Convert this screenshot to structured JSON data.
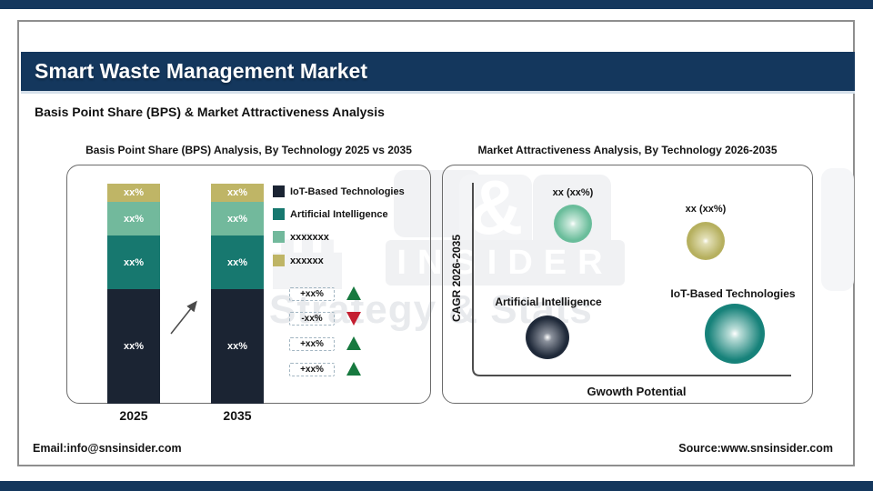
{
  "page": {
    "title": "Smart Waste Management Market",
    "subtitle": "Basis Point Share (BPS) & Market Attractiveness Analysis",
    "footer_email": "Email:info@snsinsider.com",
    "footer_source": "Source:www.snsinsider.com"
  },
  "watermark": {
    "ampersand": "&",
    "insider": "INSIDER",
    "tagline": "Strategy & Stats"
  },
  "colors": {
    "navy_header": "#14375d",
    "bar_iot": "#1b2433",
    "bar_ai": "#17786f",
    "bar_seafoam": "#72b99c",
    "bar_khaki": "#bfb566",
    "triangle_up": "#17793f",
    "triangle_down": "#c41f31",
    "bubble_green": "#6abd9b",
    "bubble_khaki": "#b6b05f",
    "bubble_navy": "#1f2939",
    "bubble_teal": "#17827a"
  },
  "chart_data": [
    {
      "type": "bar",
      "stacked": true,
      "title": "Basis Point Share (BPS) Analysis, By Technology 2025 vs 2035",
      "categories": [
        "2025",
        "2035"
      ],
      "series": [
        {
          "name": "IoT-Based Technologies",
          "color": "#1b2433",
          "values": [
            "xx%",
            "xx%"
          ]
        },
        {
          "name": "Artificial Intelligence",
          "color": "#17786f",
          "values": [
            "xx%",
            "xx%"
          ]
        },
        {
          "name": "xxxxxxx",
          "color": "#72b99c",
          "values": [
            "xx%",
            "xx%"
          ]
        },
        {
          "name": "xxxxxx",
          "color": "#bfb566",
          "values": [
            "xx%",
            "xx%"
          ]
        }
      ],
      "legend_position": "right",
      "bps_changes": [
        {
          "label": "+xx%",
          "direction": "up"
        },
        {
          "label": "-xx%",
          "direction": "down"
        },
        {
          "label": "+xx%",
          "direction": "up"
        },
        {
          "label": "+xx%",
          "direction": "up"
        }
      ]
    },
    {
      "type": "scatter",
      "subtype": "bubble",
      "title": "Market Attractiveness Analysis, By Technology 2026-2035",
      "xlabel": "Gwowth Potential",
      "ylabel": "CAGR 2026-2035",
      "grid": false,
      "bubbles": [
        {
          "label": "xx (xx%)",
          "color": "#6abd9b",
          "x": "low",
          "y": "high",
          "size": "medium"
        },
        {
          "label": "xx (xx%)",
          "color": "#b6b05f",
          "x": "high",
          "y": "high",
          "size": "medium"
        },
        {
          "label": "Artificial Intelligence",
          "color": "#1f2939",
          "x": "low",
          "y": "low",
          "size": "medium"
        },
        {
          "label": "IoT-Based Technologies",
          "color": "#17827a",
          "x": "high",
          "y": "low",
          "size": "large"
        }
      ]
    }
  ]
}
